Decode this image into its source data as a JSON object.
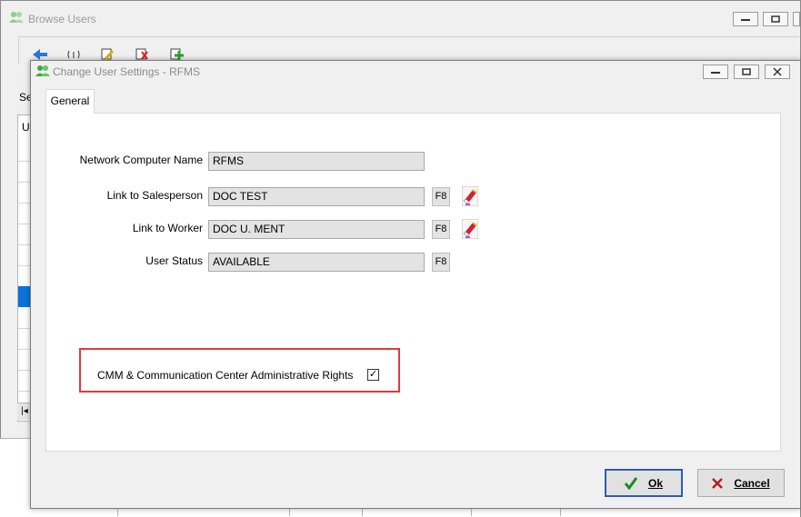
{
  "background_window": {
    "title": "Browse Users",
    "left_label": "Se",
    "grid_header_letter": "U",
    "scroll_glyph": "|◂"
  },
  "dialog": {
    "title": "Change User Settings - RFMS",
    "tab_label": "General",
    "fields": [
      {
        "label": "Network Computer Name",
        "value": "RFMS"
      },
      {
        "label": "Link to Salesperson",
        "value": "DOC TEST",
        "key": "F8"
      },
      {
        "label": "Link to Worker",
        "value": "DOC U. MENT",
        "key": "F8"
      },
      {
        "label": "User Status",
        "value": "AVAILABLE",
        "key": "F8"
      }
    ],
    "checkbox": {
      "label": "CMM & Communication Center Administrative Rights",
      "checked": true,
      "check_glyph": "✓"
    },
    "buttons": {
      "ok_label": "Ok",
      "cancel_label": "Cancel"
    }
  },
  "colors": {
    "accent": "#2b5fa8",
    "highlight_border": "#e0393e",
    "selection": "#0a73d9",
    "ok_check": "#1d8a1d",
    "cancel_x": "#b02020"
  },
  "icons": [
    "users-icon",
    "minimize-icon",
    "maximize-icon",
    "close-icon",
    "eraser-icon",
    "check-icon",
    "x-icon"
  ]
}
